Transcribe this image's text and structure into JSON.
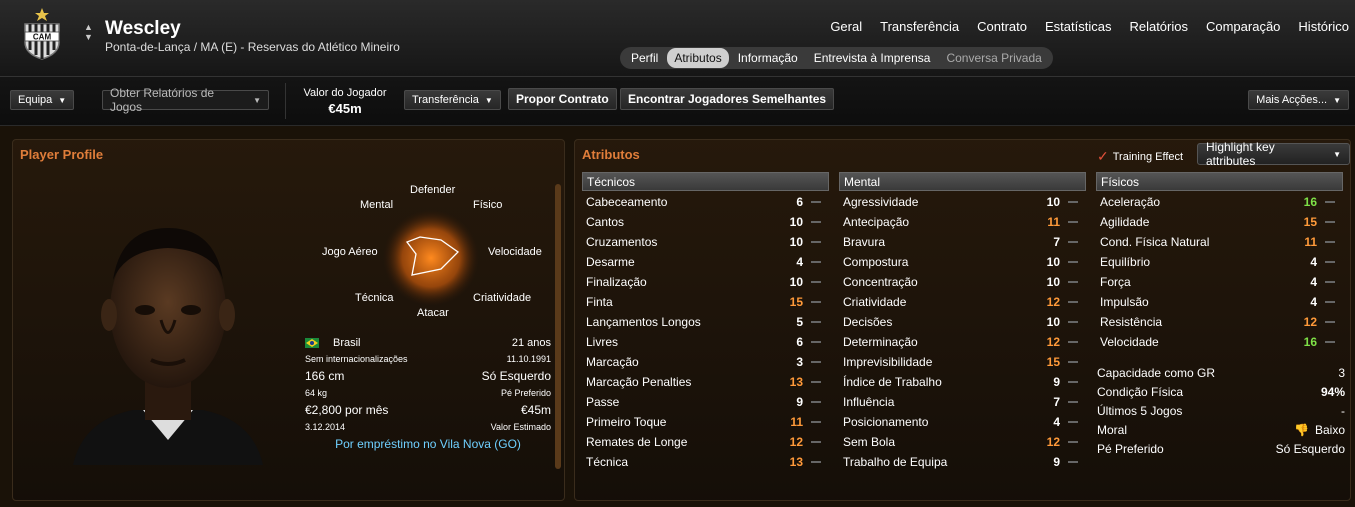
{
  "colors": {
    "accent": "#e07d3a",
    "white": "#ffffff",
    "orange": "#ff9a3a",
    "green": "#7ee047",
    "loan": "#6fd0ff"
  },
  "player": {
    "name": "Wescley",
    "subtitle": "Ponta-de-Lança / MA (E) - Reservas do Atlético Mineiro",
    "crest_text": "CAM"
  },
  "main_nav": [
    "Geral",
    "Transferência",
    "Contrato",
    "Estatísticas",
    "Relatórios",
    "Comparação",
    "Histórico"
  ],
  "sub_tabs": [
    {
      "label": "Perfil"
    },
    {
      "label": "Atributos",
      "active": true
    },
    {
      "label": "Informação"
    },
    {
      "label": "Entrevista à Imprensa"
    },
    {
      "label": "Conversa Privada",
      "dim": true
    }
  ],
  "toolbar": {
    "team": "Equipa",
    "reports": "Obter Relatórios de Jogos",
    "value_label": "Valor do Jogador",
    "value": "€45m",
    "transfer": "Transferência",
    "offer": "Propor Contrato",
    "similar": "Encontrar Jogadores Semelhantes",
    "more": "Mais Acções..."
  },
  "profile": {
    "title": "Player Profile",
    "radar_labels": {
      "top": "Defender",
      "tl": "Mental",
      "tr": "Físico",
      "ml": "Jogo Aéreo",
      "mr": "Velocidade",
      "bl": "Técnica",
      "br": "Criatividade",
      "bottom": "Atacar"
    },
    "nation": "Brasil",
    "age": "21 anos",
    "caps": "Sem internacionalizações",
    "dob": "11.10.1991",
    "height": "166 cm",
    "foot": "Só Esquerdo",
    "weight": "64 kg",
    "foot_label": "Pé Preferido",
    "wage": "€2,800 por mês",
    "est_value": "€45m",
    "contract": "3.12.2014",
    "est_label": "Valor Estimado",
    "loan": "Por empréstimo no Vila Nova (GO)"
  },
  "attributes": {
    "title": "Atributos",
    "training": "Training Effect",
    "highlight": "Highlight key attributes",
    "tecnicos_title": "Técnicos",
    "tecnicos": [
      {
        "n": "Cabeceamento",
        "v": "6",
        "c": "w"
      },
      {
        "n": "Cantos",
        "v": "10",
        "c": "w"
      },
      {
        "n": "Cruzamentos",
        "v": "10",
        "c": "w"
      },
      {
        "n": "Desarme",
        "v": "4",
        "c": "w"
      },
      {
        "n": "Finalização",
        "v": "10",
        "c": "w"
      },
      {
        "n": "Finta",
        "v": "15",
        "c": "o"
      },
      {
        "n": "Lançamentos Longos",
        "v": "5",
        "c": "w"
      },
      {
        "n": "Livres",
        "v": "6",
        "c": "w"
      },
      {
        "n": "Marcação",
        "v": "3",
        "c": "w"
      },
      {
        "n": "Marcação Penalties",
        "v": "13",
        "c": "o"
      },
      {
        "n": "Passe",
        "v": "9",
        "c": "w"
      },
      {
        "n": "Primeiro Toque",
        "v": "11",
        "c": "o"
      },
      {
        "n": "Remates de Longe",
        "v": "12",
        "c": "o"
      },
      {
        "n": "Técnica",
        "v": "13",
        "c": "o"
      }
    ],
    "mental_title": "Mental",
    "mental": [
      {
        "n": "Agressividade",
        "v": "10",
        "c": "w"
      },
      {
        "n": "Antecipação",
        "v": "11",
        "c": "o"
      },
      {
        "n": "Bravura",
        "v": "7",
        "c": "w"
      },
      {
        "n": "Compostura",
        "v": "10",
        "c": "w"
      },
      {
        "n": "Concentração",
        "v": "10",
        "c": "w"
      },
      {
        "n": "Criatividade",
        "v": "12",
        "c": "o"
      },
      {
        "n": "Decisões",
        "v": "10",
        "c": "w"
      },
      {
        "n": "Determinação",
        "v": "12",
        "c": "o"
      },
      {
        "n": "Imprevisibilidade",
        "v": "15",
        "c": "o"
      },
      {
        "n": "Índice de Trabalho",
        "v": "9",
        "c": "w"
      },
      {
        "n": "Influência",
        "v": "7",
        "c": "w"
      },
      {
        "n": "Posicionamento",
        "v": "4",
        "c": "w"
      },
      {
        "n": "Sem Bola",
        "v": "12",
        "c": "o"
      },
      {
        "n": "Trabalho de Equipa",
        "v": "9",
        "c": "w"
      }
    ],
    "fisicos_title": "Físicos",
    "fisicos": [
      {
        "n": "Aceleração",
        "v": "16",
        "c": "g"
      },
      {
        "n": "Agilidade",
        "v": "15",
        "c": "o"
      },
      {
        "n": "Cond. Física Natural",
        "v": "11",
        "c": "o"
      },
      {
        "n": "Equilíbrio",
        "v": "4",
        "c": "w"
      },
      {
        "n": "Força",
        "v": "4",
        "c": "w"
      },
      {
        "n": "Impulsão",
        "v": "4",
        "c": "w"
      },
      {
        "n": "Resistência",
        "v": "12",
        "c": "o"
      },
      {
        "n": "Velocidade",
        "v": "16",
        "c": "g"
      }
    ],
    "extra": [
      {
        "n": "Capacidade como GR",
        "v": "3"
      },
      {
        "n": "Condição Física",
        "v": "94%"
      },
      {
        "n": "Últimos 5 Jogos",
        "v": "-"
      },
      {
        "n": "Moral",
        "v": "Baixo"
      },
      {
        "n": "Pé Preferido",
        "v": "Só Esquerdo"
      }
    ]
  }
}
